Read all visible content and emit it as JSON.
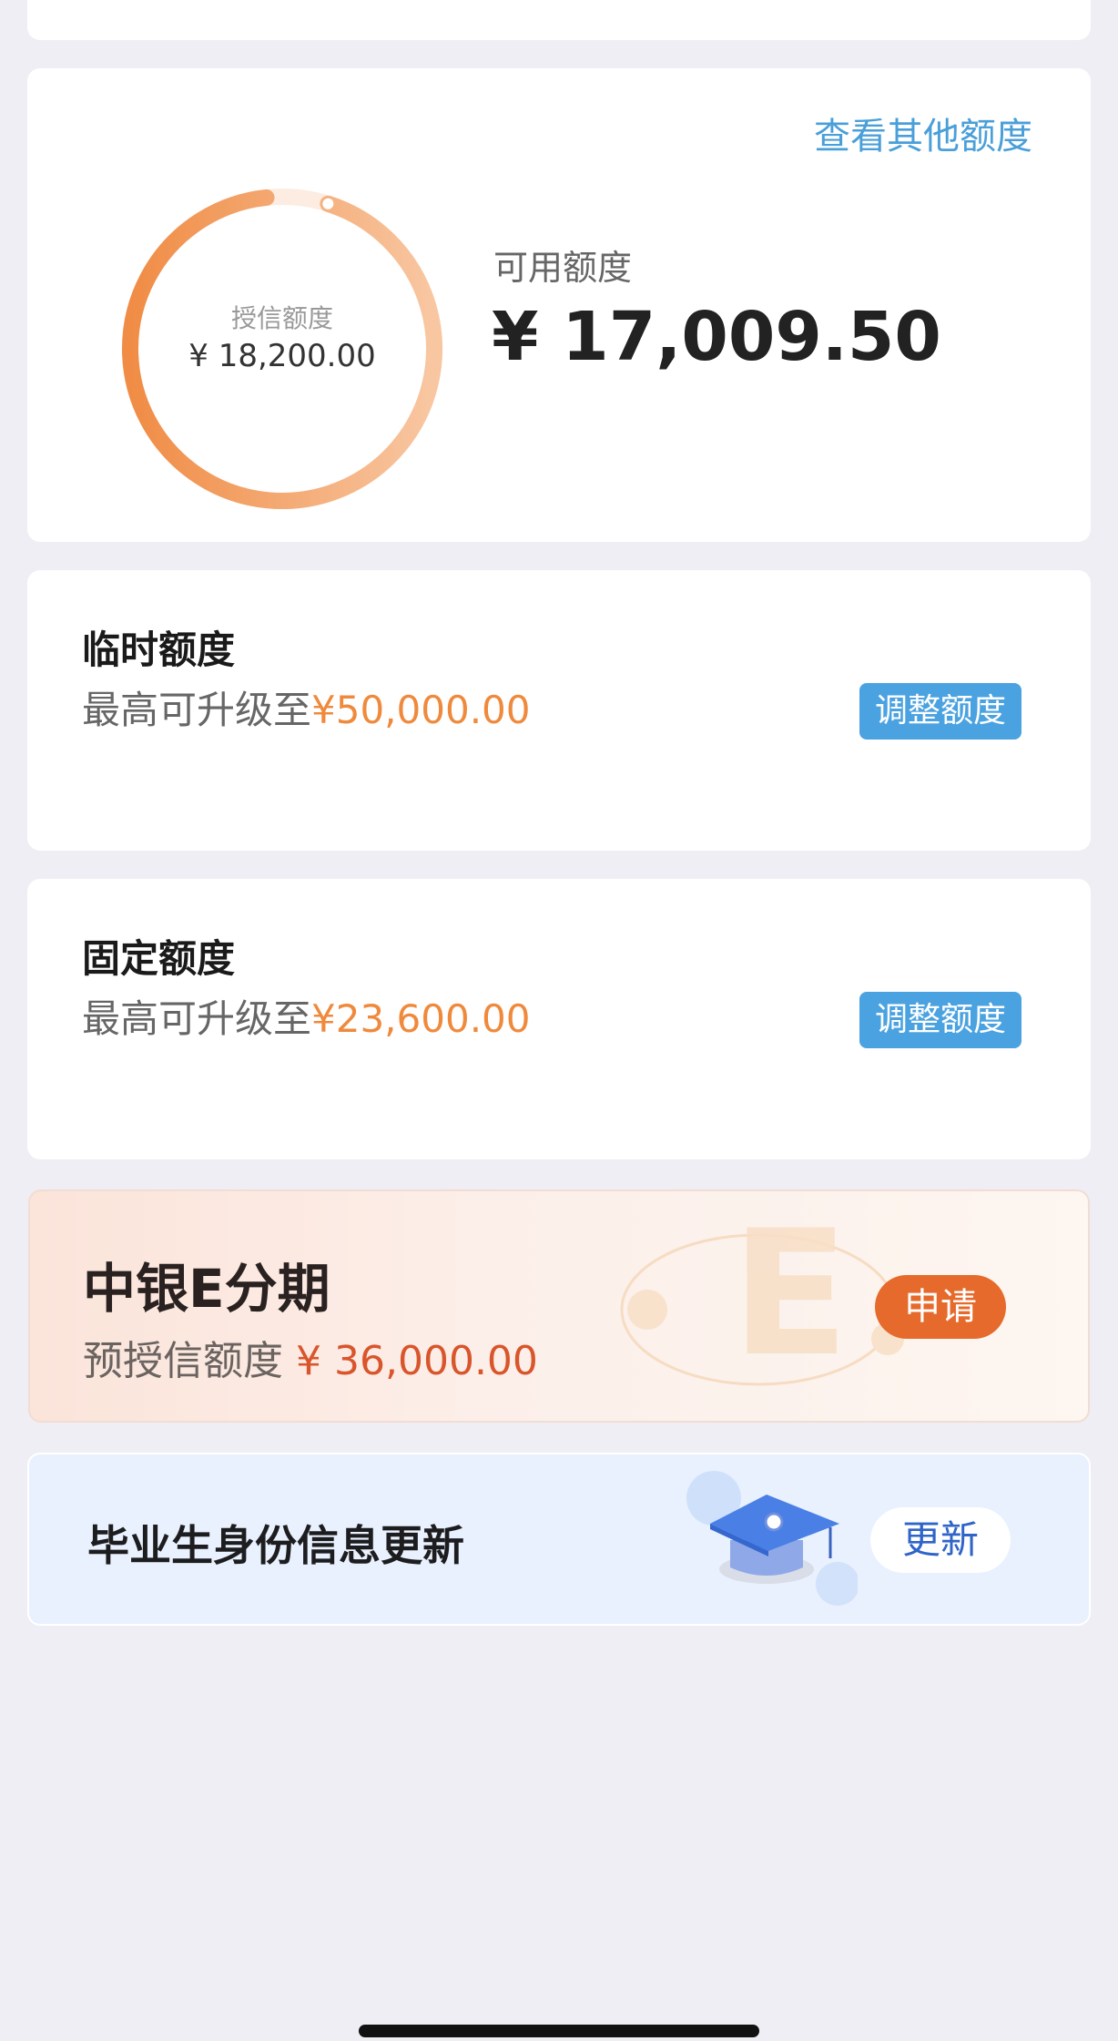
{
  "credit": {
    "other_link": "查看其他额度",
    "ring_label": "授信额度",
    "ring_amount": "¥ 18,200.00",
    "available_label": "可用额度",
    "available_amount": "¥ 17,009.50",
    "used_fraction": 0.9346,
    "colors": {
      "ring_start": "#f08c45",
      "ring_end": "#f8c7a2",
      "track": "#fdece1"
    }
  },
  "temporary": {
    "title": "临时额度",
    "desc_prefix": "最高可升级至",
    "desc_amount": "¥50,000.00",
    "button": "调整额度"
  },
  "fixed": {
    "title": "固定额度",
    "desc_prefix": "最高可升级至",
    "desc_amount": "¥23,600.00",
    "button": "调整额度"
  },
  "estage": {
    "title": "中银E分期",
    "desc_prefix": "预授信额度",
    "desc_amount": "¥ 36,000.00",
    "button": "申请",
    "deco_letter": "E"
  },
  "graduate": {
    "title": "毕业生身份信息更新",
    "button": "更新",
    "icon": "graduation-cap-icon"
  },
  "colors": {
    "accent_blue": "#4ba2e0",
    "accent_orange": "#ef8a3d",
    "estage_orange": "#e66a2b"
  }
}
